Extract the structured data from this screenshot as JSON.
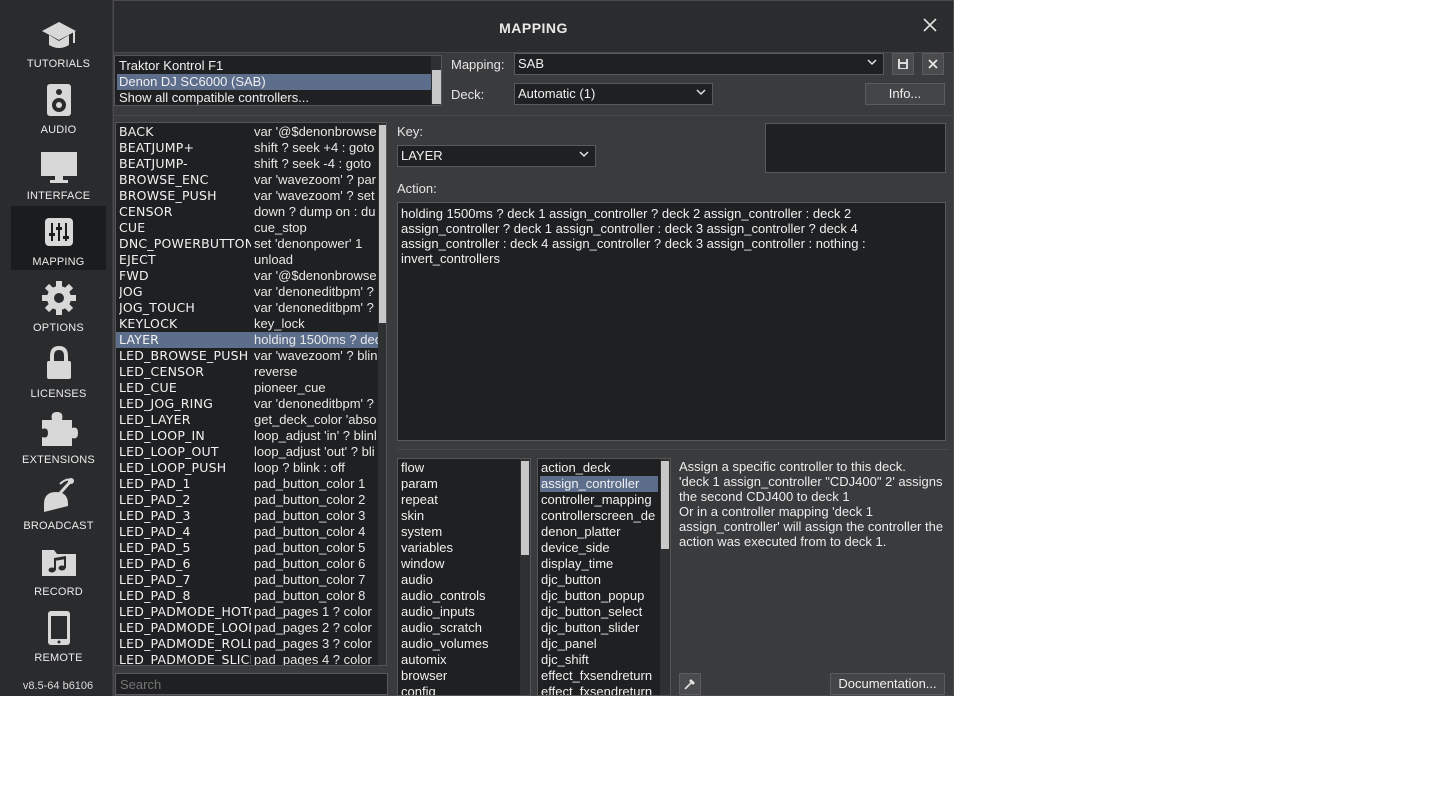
{
  "sidebar": {
    "items": [
      {
        "label": "TUTORIALS",
        "icon": "graduation-cap-icon"
      },
      {
        "label": "AUDIO",
        "icon": "speaker-icon"
      },
      {
        "label": "INTERFACE",
        "icon": "monitor-icon"
      },
      {
        "label": "MAPPING",
        "icon": "sliders-icon"
      },
      {
        "label": "OPTIONS",
        "icon": "gear-icon"
      },
      {
        "label": "LICENSES",
        "icon": "lock-icon"
      },
      {
        "label": "EXTENSIONS",
        "icon": "puzzle-icon"
      },
      {
        "label": "BROADCAST",
        "icon": "broadcast-icon"
      },
      {
        "label": "RECORD",
        "icon": "music-folder-icon"
      },
      {
        "label": "REMOTE",
        "icon": "tablet-icon"
      }
    ],
    "active": "MAPPING",
    "version": "v8.5-64 b6106"
  },
  "dialog": {
    "title": "MAPPING",
    "controllers": [
      {
        "label": "Traktor Kontrol F1",
        "selected": false
      },
      {
        "label": "Denon DJ SC6000 (SAB)",
        "selected": true
      },
      {
        "label": "Show all compatible controllers...",
        "selected": false
      }
    ],
    "mapping_label": "Mapping:",
    "mapping_value": "SAB",
    "deck_label": "Deck:",
    "deck_value": "Automatic (1)",
    "info_button": "Info...",
    "key_label": "Key:",
    "key_value": "LAYER",
    "action_label": "Action:",
    "action_text": "holding 1500ms ? deck 1 assign_controller ? deck 2 assign_controller : deck 2 assign_controller ? deck 1 assign_controller : deck 3 assign_controller ? deck 4 assign_controller : deck 4 assign_controller ? deck 3 assign_controller : nothing : invert_controllers",
    "search_placeholder": "Search",
    "documentation_button": "Documentation...",
    "keys": [
      {
        "name": "BACK",
        "action": "var '@$denonbrowse"
      },
      {
        "name": "BEATJUMP+",
        "action": "shift ? seek +4 : goto"
      },
      {
        "name": "BEATJUMP-",
        "action": "shift ? seek -4 : goto"
      },
      {
        "name": "BROWSE_ENC",
        "action": "var 'wavezoom' ? par"
      },
      {
        "name": "BROWSE_PUSH",
        "action": "var 'wavezoom' ? set"
      },
      {
        "name": "CENSOR",
        "action": "down ? dump on : du"
      },
      {
        "name": "CUE",
        "action": "cue_stop"
      },
      {
        "name": "DNC_POWERBUTTON",
        "action": "set 'denonpower' 1"
      },
      {
        "name": "EJECT",
        "action": "unload"
      },
      {
        "name": "FWD",
        "action": "var '@$denonbrowse"
      },
      {
        "name": "JOG",
        "action": "var 'denoneditbpm' ?"
      },
      {
        "name": "JOG_TOUCH",
        "action": "var 'denoneditbpm' ?"
      },
      {
        "name": "KEYLOCK",
        "action": "key_lock"
      },
      {
        "name": "LAYER",
        "action": "holding 1500ms ? deck"
      },
      {
        "name": "LED_BROWSE_PUSH",
        "action": "var 'wavezoom' ? blin"
      },
      {
        "name": "LED_CENSOR",
        "action": "reverse"
      },
      {
        "name": "LED_CUE",
        "action": "pioneer_cue"
      },
      {
        "name": "LED_JOG_RING",
        "action": "var 'denoneditbpm' ?"
      },
      {
        "name": "LED_LAYER",
        "action": "get_deck_color 'abso"
      },
      {
        "name": "LED_LOOP_IN",
        "action": "loop_adjust 'in' ? blinl"
      },
      {
        "name": "LED_LOOP_OUT",
        "action": "loop_adjust 'out' ? bli"
      },
      {
        "name": "LED_LOOP_PUSH",
        "action": "loop ? blink : off"
      },
      {
        "name": "LED_PAD_1",
        "action": "pad_button_color 1"
      },
      {
        "name": "LED_PAD_2",
        "action": "pad_button_color 2"
      },
      {
        "name": "LED_PAD_3",
        "action": "pad_button_color 3"
      },
      {
        "name": "LED_PAD_4",
        "action": "pad_button_color 4"
      },
      {
        "name": "LED_PAD_5",
        "action": "pad_button_color 5"
      },
      {
        "name": "LED_PAD_6",
        "action": "pad_button_color 6"
      },
      {
        "name": "LED_PAD_7",
        "action": "pad_button_color 7"
      },
      {
        "name": "LED_PAD_8",
        "action": "pad_button_color 8"
      },
      {
        "name": "LED_PADMODE_HOTCUE",
        "action": "pad_pages 1 ? color"
      },
      {
        "name": "LED_PADMODE_LOOP",
        "action": "pad_pages 2 ? color"
      },
      {
        "name": "LED_PADMODE_ROLL",
        "action": "pad_pages 3 ? color"
      },
      {
        "name": "LED_PADMODE_SLICER",
        "action": "pad_pages 4 ? color"
      }
    ],
    "selected_key_index": 13,
    "categories": [
      "flow",
      "param",
      "repeat",
      "skin",
      "system",
      "variables",
      "window",
      "audio",
      "audio_controls",
      "audio_inputs",
      "audio_scratch",
      "audio_volumes",
      "automix",
      "browser",
      "config"
    ],
    "verbs": [
      "action_deck",
      "assign_controller",
      "controller_mapping",
      "controllerscreen_de",
      "denon_platter",
      "device_side",
      "display_time",
      "djc_button",
      "djc_button_popup",
      "djc_button_select",
      "djc_button_slider",
      "djc_panel",
      "djc_shift",
      "effect_fxsendreturn",
      "effect_fxsendreturn"
    ],
    "selected_verb_index": 1,
    "documentation_text": "Assign a specific controller to this deck.\n'deck 1 assign_controller \"CDJ400\" 2' assigns the second CDJ400 to deck 1\nOr in a controller mapping 'deck 1 assign_controller' will assign the controller the action was executed from to deck 1."
  },
  "colors": {
    "background": "#2a2b2d",
    "panel": "#3a3b3d",
    "selection": "#5d6e8c",
    "field": "#1f2022"
  }
}
